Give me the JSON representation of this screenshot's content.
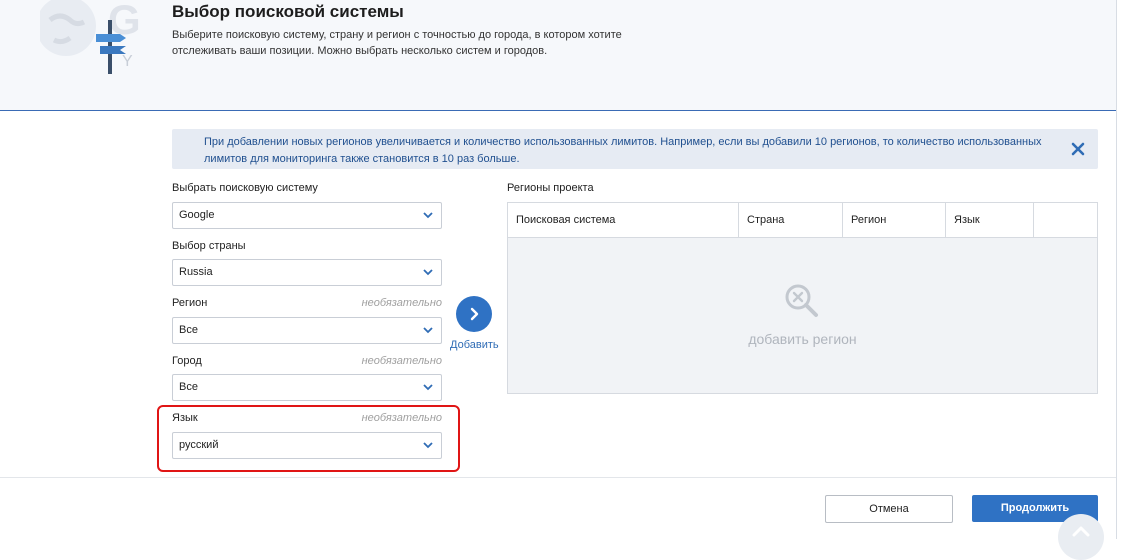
{
  "header": {
    "title": "Выбор поисковой системы",
    "description": "Выберите поисковую систему, страну и регион с точностью до города, в котором хотите отслеживать ваши позиции. Можно выбрать несколько систем и городов."
  },
  "info": {
    "text": "При добавлении новых регионов увеличивается и количество использованных лимитов. Например, если вы добавили 10 регионов, то количество использованных лимитов для мониторинга также становится в 10 раз больше."
  },
  "form": {
    "search_engine": {
      "label": "Выбрать поисковую систему",
      "value": "Google"
    },
    "country": {
      "label": "Выбор страны",
      "value": "Russia"
    },
    "region": {
      "label": "Регион",
      "optional": "необязательно",
      "value": "Все"
    },
    "city": {
      "label": "Город",
      "optional": "необязательно",
      "value": "Все"
    },
    "language": {
      "label": "Язык",
      "optional": "необязательно",
      "value": "русский"
    }
  },
  "add": {
    "label": "Добавить"
  },
  "regions": {
    "title": "Регионы проекта",
    "columns": [
      "Поисковая система",
      "Страна",
      "Регион",
      "Язык",
      ""
    ],
    "empty_text": "добавить регион"
  },
  "footer": {
    "cancel_label": "Отмена",
    "continue_label": "Продолжить"
  },
  "colors": {
    "accent": "#2f72c4",
    "highlight": "#e01515",
    "info_bg": "#e6ebf3"
  }
}
